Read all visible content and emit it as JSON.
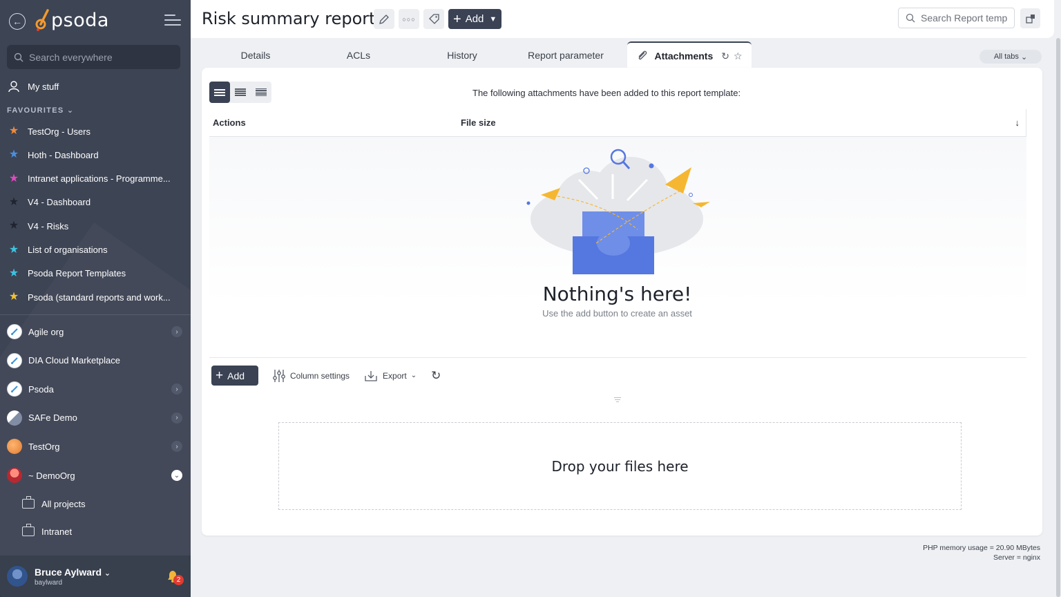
{
  "sidebar": {
    "brand": "psoda",
    "search_placeholder": "Search everywhere",
    "my_stuff": "My stuff",
    "favourites_heading": "FAVOURITES",
    "favourites": [
      {
        "label": "TestOrg - Users",
        "color": "#f08a3c"
      },
      {
        "label": "Hoth - Dashboard",
        "color": "#4a90e2"
      },
      {
        "label": "Intranet applications - Programme...",
        "color": "#e04ac0"
      },
      {
        "label": "V4 - Dashboard",
        "color": "#1f2430"
      },
      {
        "label": "V4 - Risks",
        "color": "#1f2430"
      },
      {
        "label": "List of organisations",
        "color": "#3ec3e0"
      },
      {
        "label": "Psoda Report Templates",
        "color": "#3ec3e0"
      },
      {
        "label": "Psoda (standard reports and work...",
        "color": "#f2c230"
      }
    ],
    "orgs": [
      {
        "label": "Agile org",
        "has_chevron": true
      },
      {
        "label": "DIA Cloud Marketplace",
        "has_chevron": false
      },
      {
        "label": "Psoda",
        "has_chevron": true
      },
      {
        "label": "SAFe Demo",
        "has_chevron": true
      },
      {
        "label": "TestOrg",
        "has_chevron": true
      },
      {
        "label": "~ DemoOrg",
        "has_chevron": true
      }
    ],
    "subitems": [
      "All projects",
      "Intranet"
    ],
    "user": {
      "name": "Bruce Aylward",
      "login": "baylward",
      "notifications": "2"
    }
  },
  "header": {
    "title": "Risk summary report",
    "add_label": "Add",
    "search_placeholder": "Search Report temp"
  },
  "tabs": [
    {
      "label": "Details"
    },
    {
      "label": "ACLs"
    },
    {
      "label": "History"
    },
    {
      "label": "Report parameter"
    },
    {
      "label": "Attachments",
      "active": true
    }
  ],
  "all_tabs_label": "All tabs",
  "main": {
    "intro": "The following attachments have been added to this report template:",
    "columns": [
      "Actions",
      "File size"
    ],
    "empty_title": "Nothing's here!",
    "empty_subtitle": "Use the add button to create an asset",
    "toolbar": {
      "add": "Add",
      "column_settings": "Column settings",
      "export": "Export"
    },
    "dropzone": "Drop your files here"
  },
  "footer": {
    "memory": "PHP memory usage = 20.90 MBytes",
    "server": "Server = nginx"
  }
}
